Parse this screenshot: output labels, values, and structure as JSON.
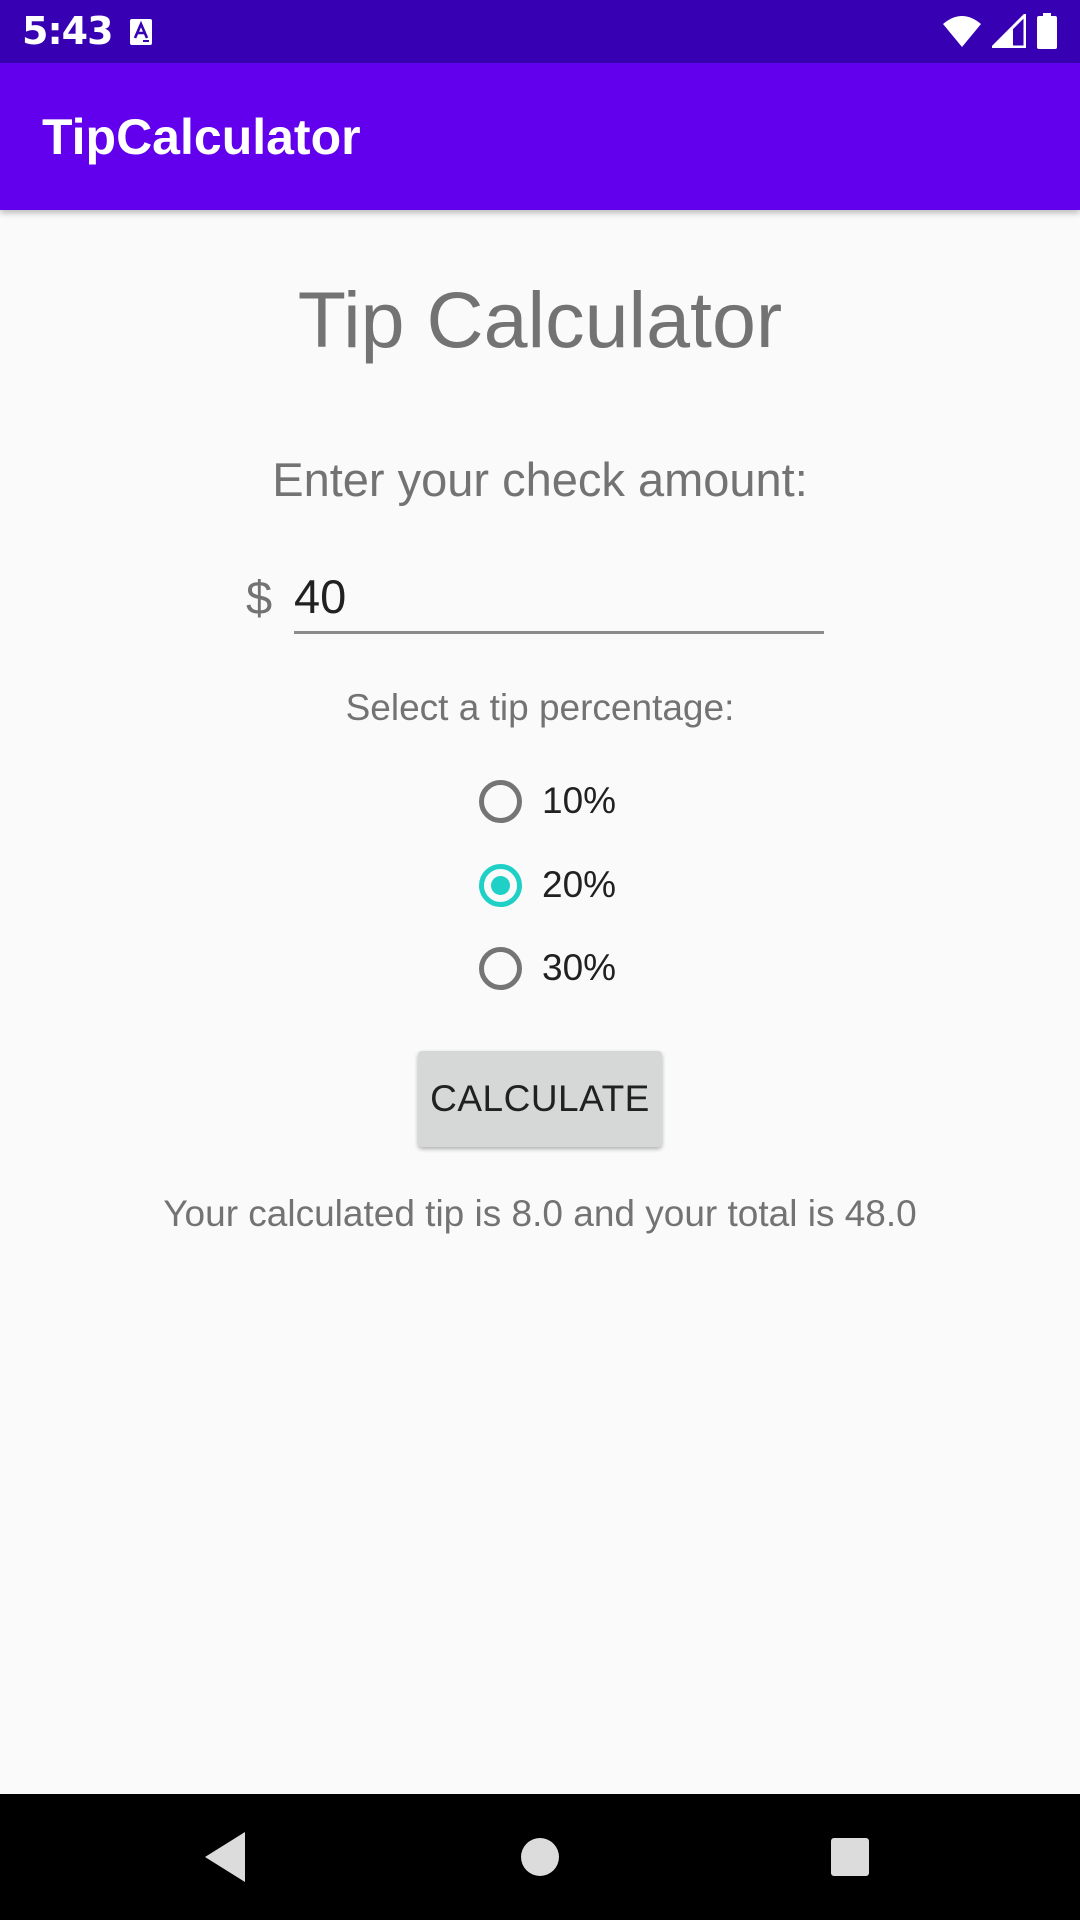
{
  "status_bar": {
    "time": "5:43",
    "icons": [
      "notification-a-icon",
      "wifi-icon",
      "signal-icon",
      "battery-icon"
    ]
  },
  "app_bar": {
    "title": "TipCalculator",
    "color": "#6200ee"
  },
  "main": {
    "title": "Tip Calculator",
    "prompt": "Enter your check amount:",
    "currency_symbol": "$",
    "amount_value": "40",
    "tip_label": "Select a tip percentage:",
    "tip_options": [
      {
        "label": "10%",
        "selected": false
      },
      {
        "label": "20%",
        "selected": true
      },
      {
        "label": "30%",
        "selected": false
      }
    ],
    "calculate_label": "CALCULATE",
    "result_text": "Your calculated tip is 8.0 and your total is 48.0",
    "accent_color": "#1ed0c6"
  },
  "nav_bar": {
    "buttons": [
      "back-icon",
      "home-icon",
      "recents-icon"
    ]
  }
}
